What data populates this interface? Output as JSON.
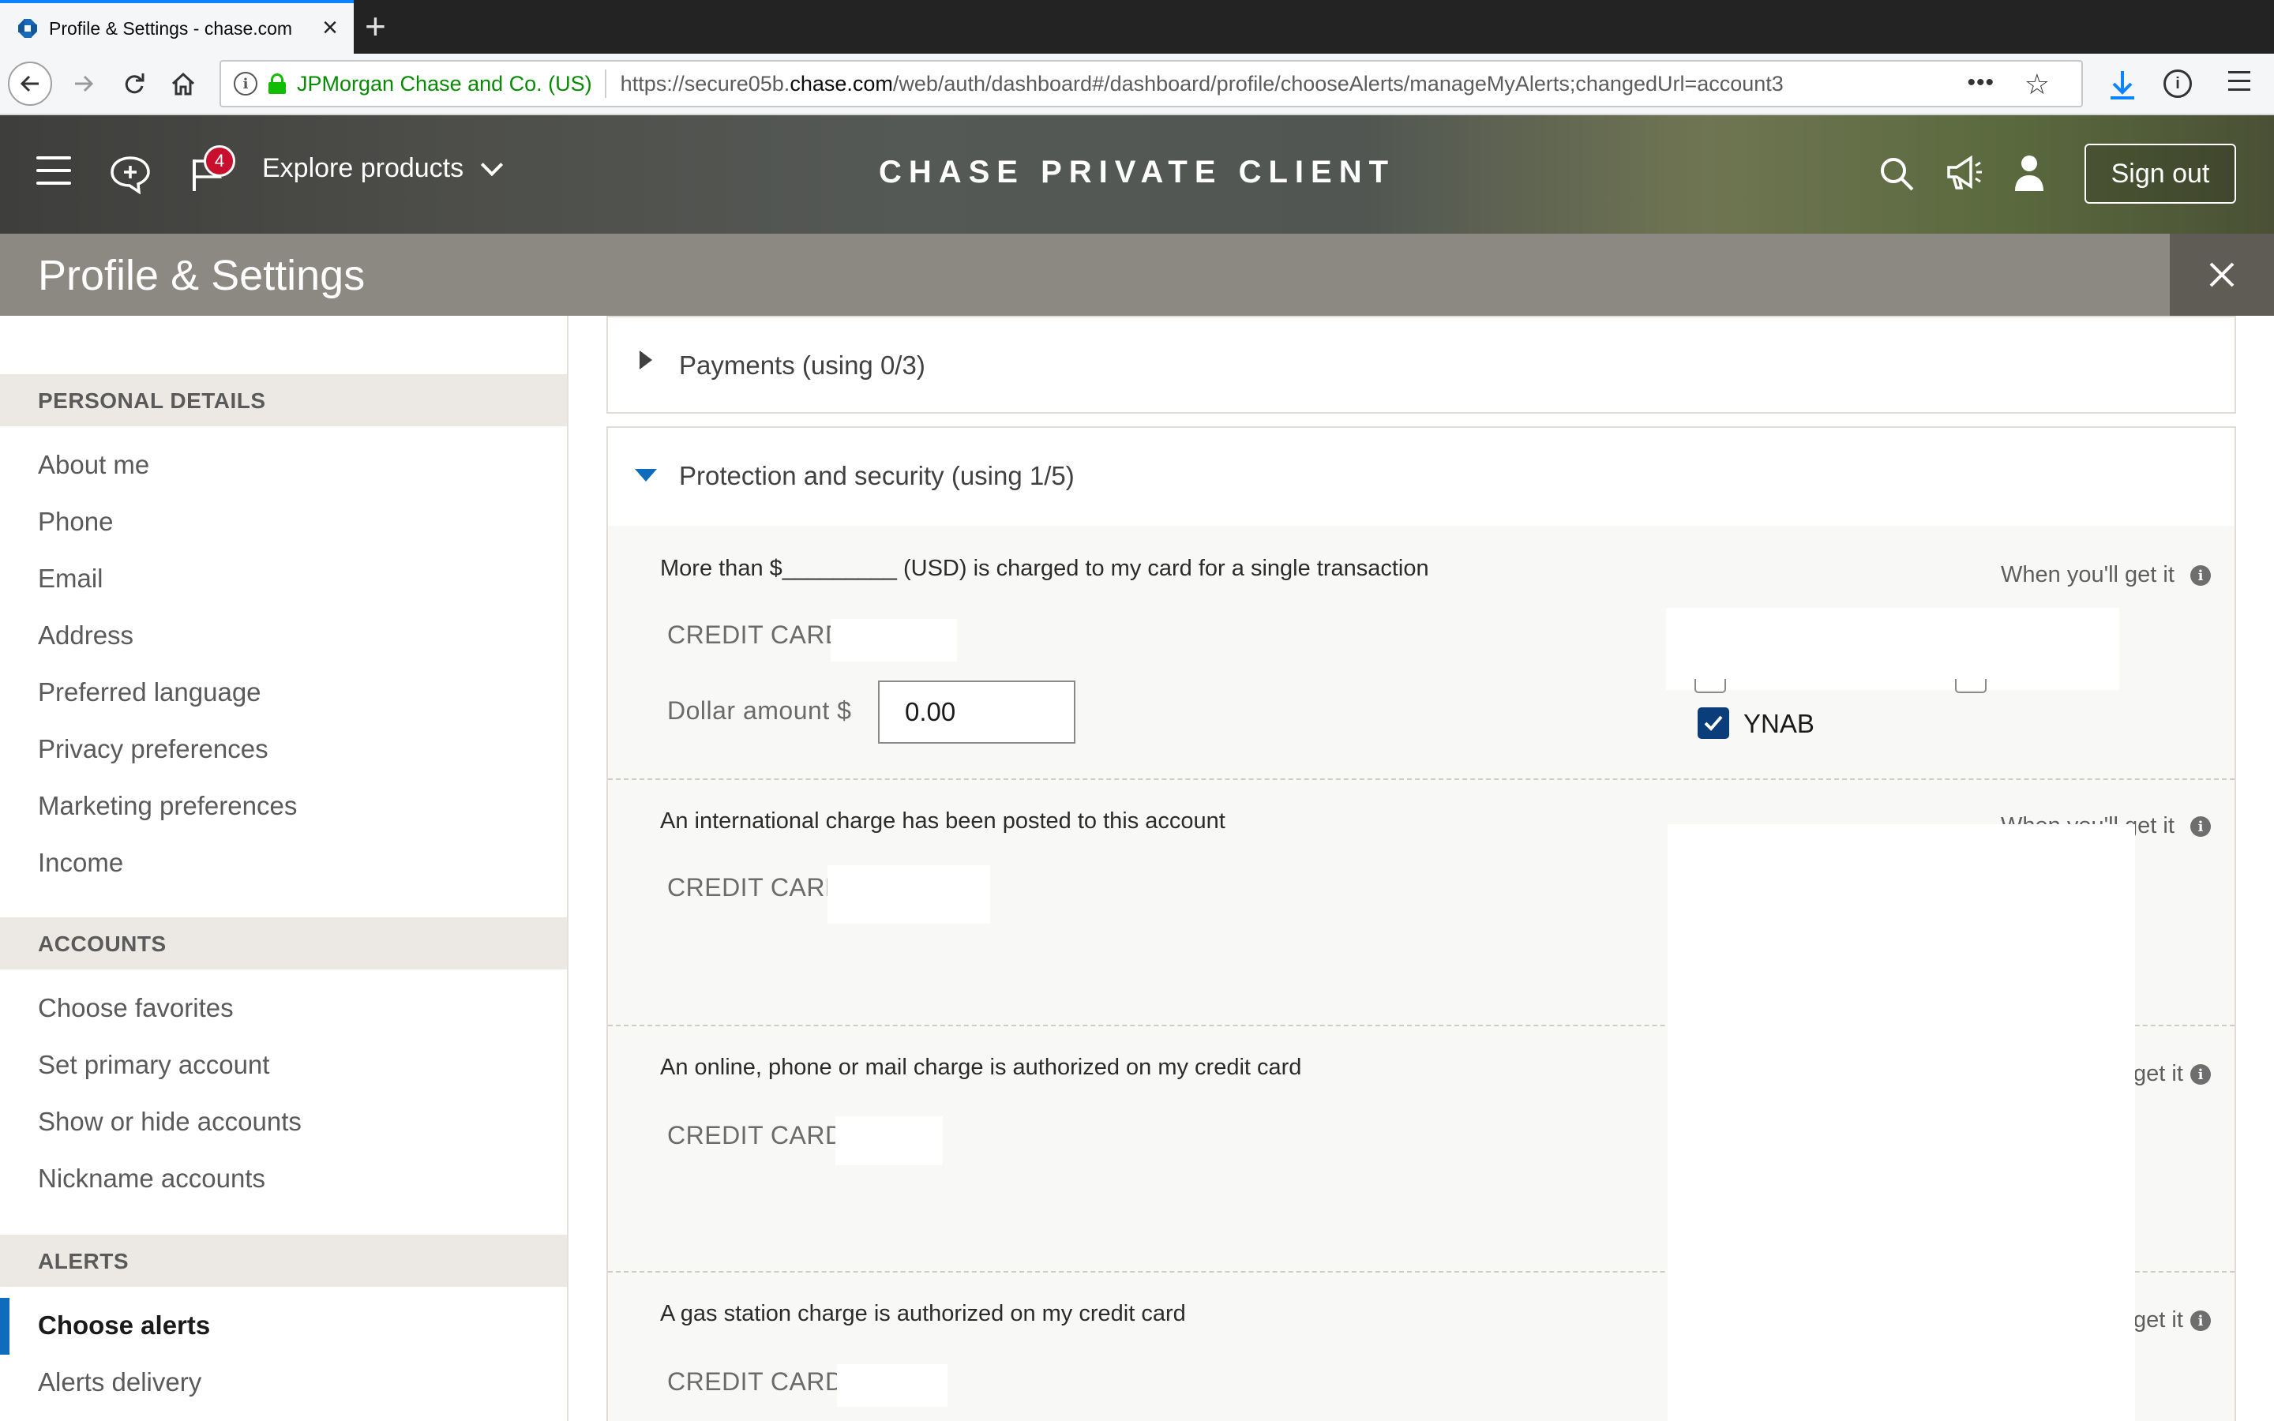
{
  "browser": {
    "tab_title": "Profile & Settings - chase.com",
    "url_org": "JPMorgan Chase and Co. (US)",
    "url_prefix": "https://secure05b.",
    "url_domain": "chase.com",
    "url_path": "/web/auth/dashboard#/dashboard/profile/chooseAlerts/manageMyAlerts;changedUrl=account3",
    "icons": [
      "back-icon",
      "forward-icon",
      "reload-icon",
      "home-icon",
      "info-icon",
      "lock-icon",
      "more-icon",
      "star-icon",
      "download-icon",
      "password-icon",
      "menu-icon"
    ]
  },
  "header": {
    "notification_count": "4",
    "explore_label": "Explore products",
    "brand": "CHASE PRIVATE CLIENT",
    "signout_label": "Sign out"
  },
  "page": {
    "title": "Profile & Settings"
  },
  "sidebar": {
    "sections": [
      {
        "title": "PERSONAL DETAILS",
        "items": [
          "About me",
          "Phone",
          "Email",
          "Address",
          "Preferred language",
          "Privacy preferences",
          "Marketing preferences",
          "Income"
        ]
      },
      {
        "title": "ACCOUNTS",
        "items": [
          "Choose favorites",
          "Set primary account",
          "Show or hide accounts",
          "Nickname accounts"
        ]
      },
      {
        "title": "ALERTS",
        "items": [
          "Choose alerts",
          "Alerts delivery"
        ]
      }
    ],
    "active_item": "Choose alerts"
  },
  "main": {
    "groups": [
      {
        "label": "Payments (using 0/3)",
        "expanded": false
      },
      {
        "label": "Protection and security (using 1/5)",
        "expanded": true
      }
    ],
    "alerts": [
      {
        "description": "More than $_________ (USD) is charged to my card for a single transaction",
        "account_label": "CREDIT CARD",
        "when_label": "When you'll get it",
        "amount_label": "Dollar amount $",
        "amount_value": "0.00",
        "delivery_option": "YNAB",
        "delivery_checked": true
      },
      {
        "description": "An international charge has been posted to this account",
        "account_label": "CREDIT CARD",
        "when_label": "When you'll get it"
      },
      {
        "description": "An online, phone or mail charge is authorized on my credit card",
        "account_label": "CREDIT CARD",
        "when_label": "get it"
      },
      {
        "description": "A gas station charge is authorized on my credit card",
        "account_label": "CREDIT CARD",
        "when_label": "get it"
      }
    ],
    "accent_color": "#0f6cbd"
  }
}
